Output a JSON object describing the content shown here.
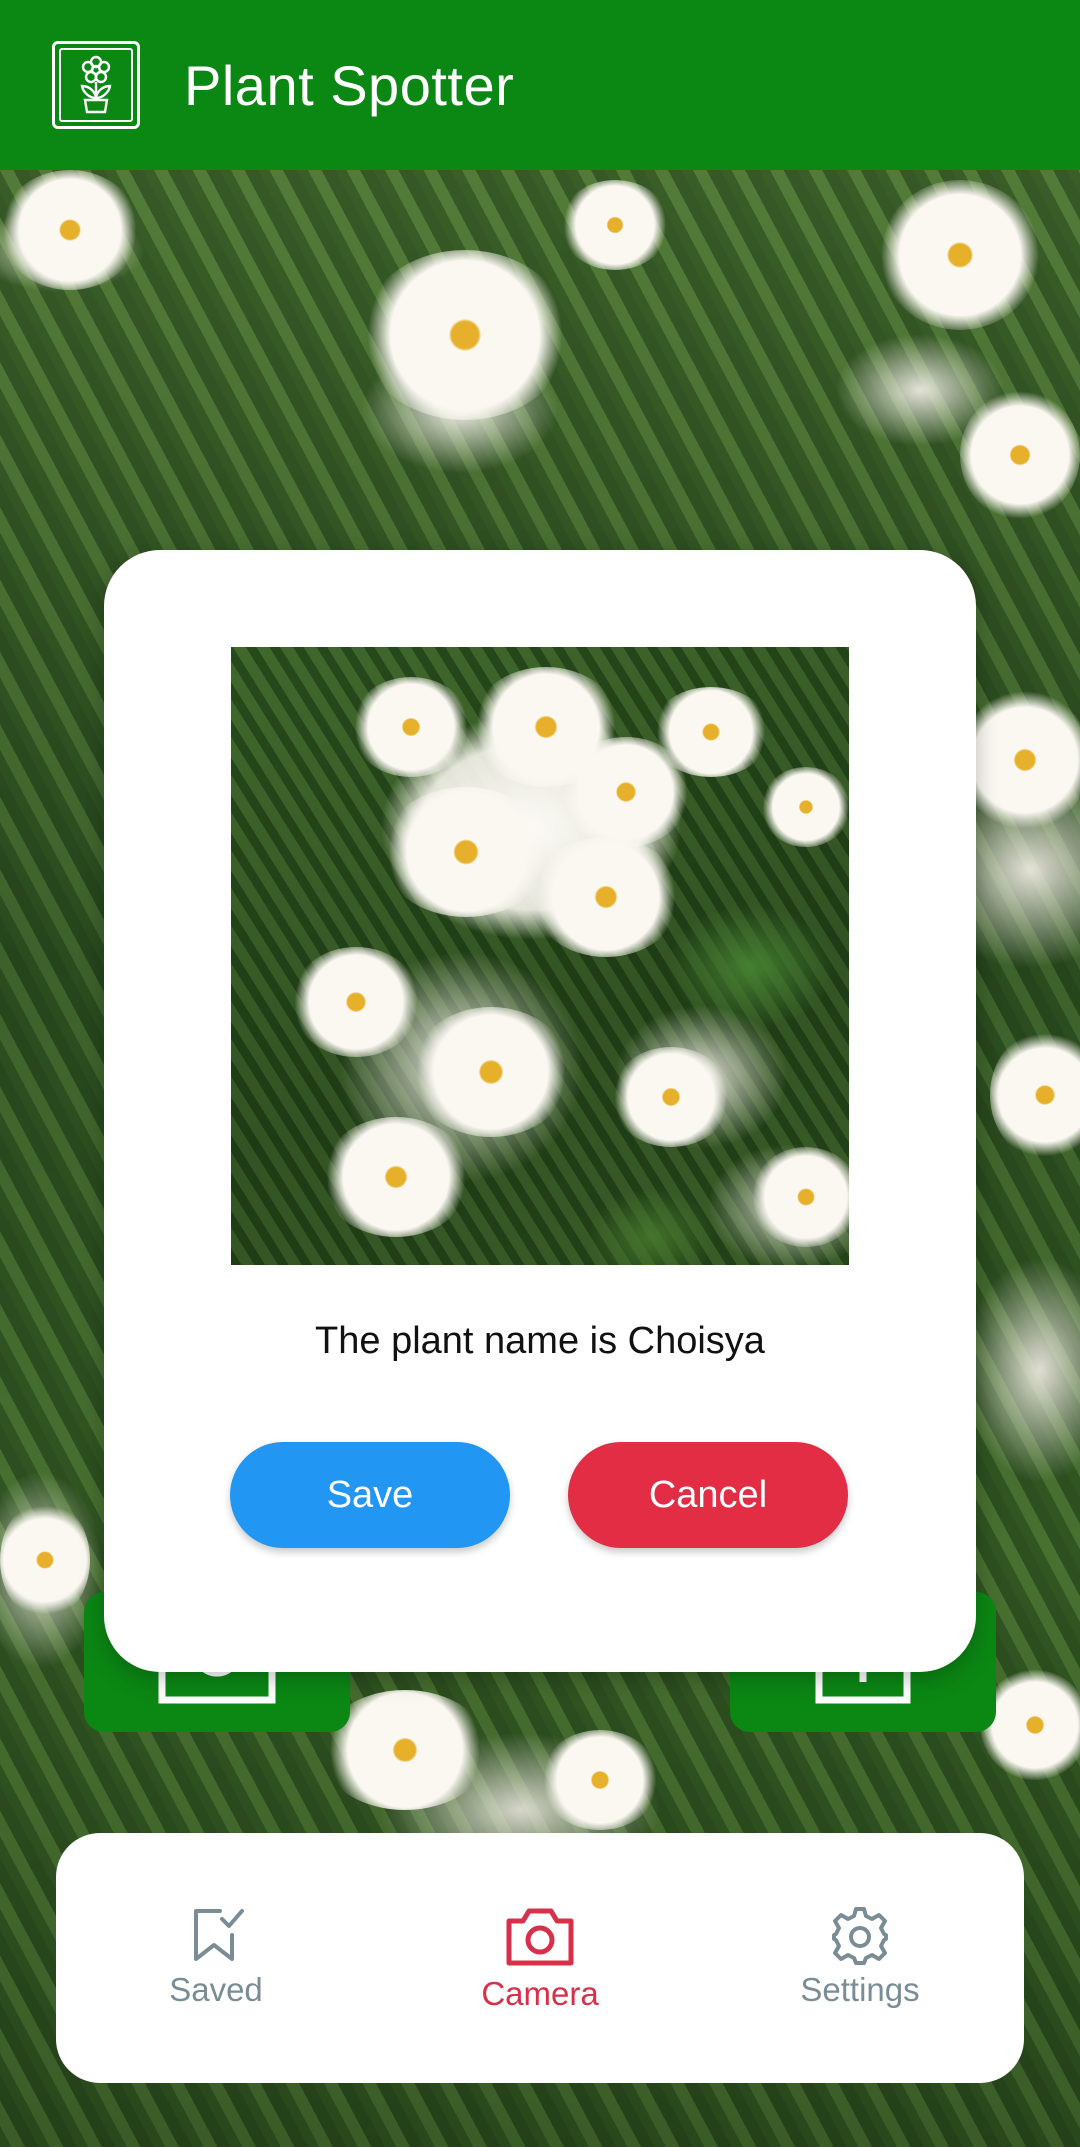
{
  "app": {
    "title": "Plant Spotter",
    "logo_icon": "flower-pot-icon",
    "bar_color": "#0b8714"
  },
  "dialog": {
    "result_text": "The plant name is Choisya",
    "save_label": "Save",
    "cancel_label": "Cancel",
    "save_color": "#2196f3",
    "cancel_color": "#e22d44"
  },
  "actions": {
    "left_icon": "camera-icon",
    "right_icon": "upload-icon"
  },
  "bottom_nav": {
    "items": [
      {
        "label": "Saved",
        "icon": "bookmark-check-icon",
        "active": false
      },
      {
        "label": "Camera",
        "icon": "camera-icon",
        "active": true
      },
      {
        "label": "Settings",
        "icon": "gear-icon",
        "active": false
      }
    ],
    "active_color": "#d6304a",
    "inactive_color": "#7a8d96"
  }
}
